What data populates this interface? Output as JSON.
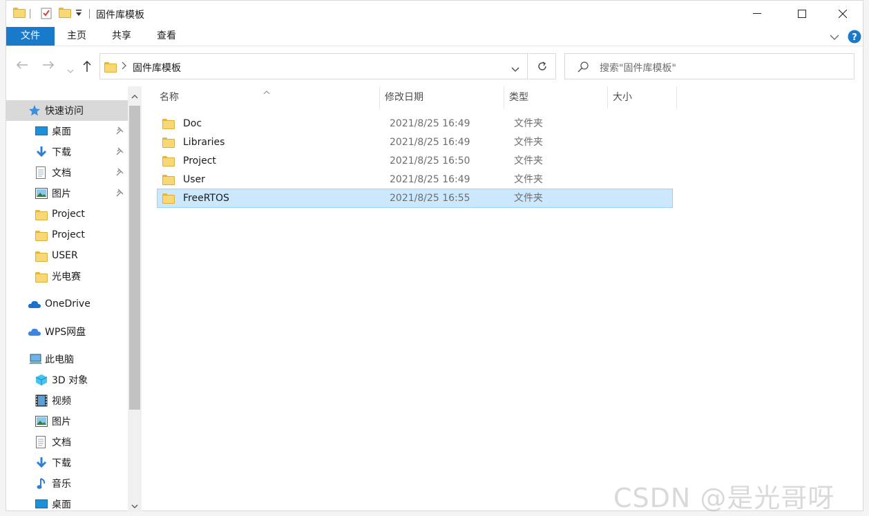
{
  "window": {
    "title": "固件库模板"
  },
  "ribbon": {
    "tabs": [
      "文件",
      "主页",
      "共享",
      "查看"
    ]
  },
  "address": {
    "path": "固件库模板",
    "search_placeholder": "搜索\"固件库模板\""
  },
  "nav": {
    "items": [
      {
        "label": "快速访问",
        "icon": "star-icon"
      },
      {
        "label": "桌面",
        "icon": "desktop-icon",
        "pinned": true
      },
      {
        "label": "下载",
        "icon": "download-icon",
        "pinned": true
      },
      {
        "label": "文档",
        "icon": "document-icon",
        "pinned": true
      },
      {
        "label": "图片",
        "icon": "picture-icon",
        "pinned": true
      },
      {
        "label": "Project",
        "icon": "folder-icon"
      },
      {
        "label": "Project",
        "icon": "folder-icon"
      },
      {
        "label": "USER",
        "icon": "folder-icon"
      },
      {
        "label": "光电赛",
        "icon": "folder-icon"
      },
      {
        "label": "OneDrive",
        "icon": "cloud-icon"
      },
      {
        "label": "WPS网盘",
        "icon": "cloud-icon"
      },
      {
        "label": "此电脑",
        "icon": "computer-icon"
      },
      {
        "label": "3D 对象",
        "icon": "cube-icon"
      },
      {
        "label": "视频",
        "icon": "video-icon"
      },
      {
        "label": "图片",
        "icon": "picture-icon"
      },
      {
        "label": "文档",
        "icon": "document-icon"
      },
      {
        "label": "下载",
        "icon": "download-icon"
      },
      {
        "label": "音乐",
        "icon": "music-icon"
      },
      {
        "label": "桌面",
        "icon": "desktop-icon"
      }
    ]
  },
  "columns": {
    "name": "名称",
    "date": "修改日期",
    "type": "类型",
    "size": "大小"
  },
  "files": [
    {
      "name": "Doc",
      "date": "2021/8/25 16:49",
      "type": "文件夹"
    },
    {
      "name": "Libraries",
      "date": "2021/8/25 16:49",
      "type": "文件夹"
    },
    {
      "name": "Project",
      "date": "2021/8/25 16:50",
      "type": "文件夹"
    },
    {
      "name": "User",
      "date": "2021/8/25 16:49",
      "type": "文件夹"
    },
    {
      "name": "FreeRTOS",
      "date": "2021/8/25 16:55",
      "type": "文件夹",
      "selected": true
    }
  ],
  "watermark": "CSDN @是光哥呀",
  "colors": {
    "accent": "#1979ca",
    "selection": "#cce8ff",
    "folder": "#f8d775"
  }
}
